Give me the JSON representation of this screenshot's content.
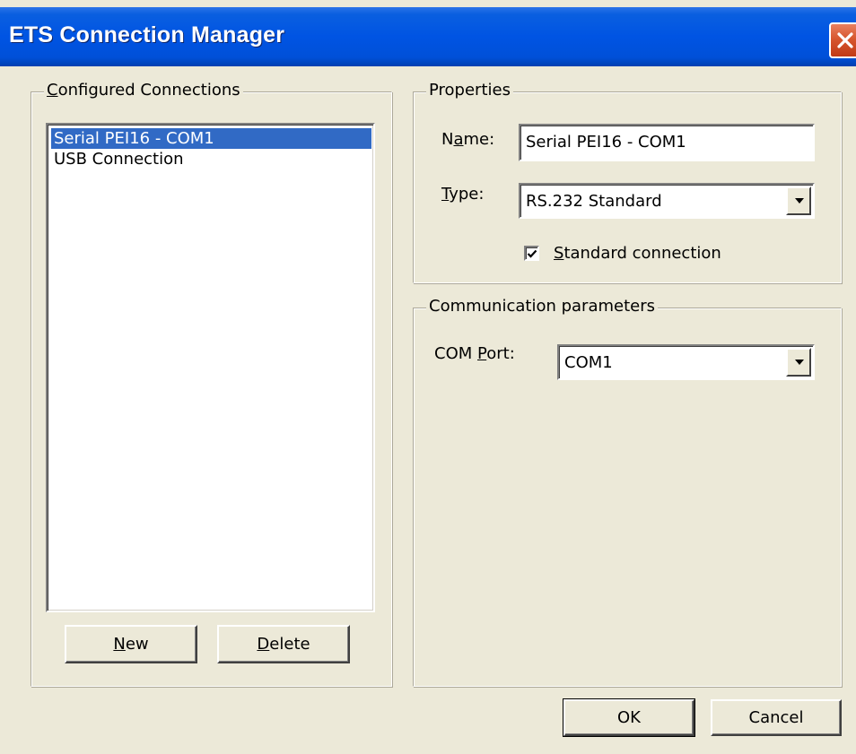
{
  "window": {
    "title": "ETS Connection Manager"
  },
  "configured_connections": {
    "legend_first": "C",
    "legend_rest": "onfigured Connections",
    "items": [
      {
        "label": "Serial PEI16 - COM1",
        "selected": true
      },
      {
        "label": "USB Connection",
        "selected": false
      }
    ],
    "new_button": {
      "first": "N",
      "rest": "ew"
    },
    "delete_button": {
      "first": "D",
      "rest": "elete"
    }
  },
  "properties": {
    "legend": "Properties",
    "name_label": {
      "before": "N",
      "underlined": "a",
      "after": "me:"
    },
    "name_value": "Serial PEI16 - COM1",
    "type_label": {
      "underlined": "T",
      "after": "ype:"
    },
    "type_value": "RS.232 Standard",
    "standard_connection": {
      "first": "S",
      "rest": "tandard connection",
      "checked": true
    }
  },
  "communication": {
    "legend": "Communication parameters",
    "com_port_label": {
      "before": "COM ",
      "underlined": "P",
      "after": "ort:"
    },
    "com_port_value": "COM1"
  },
  "footer": {
    "ok_label": "OK",
    "cancel_label": "Cancel"
  },
  "colors": {
    "titlebar": "#0054e3",
    "selection": "#316ac5",
    "dialog_background": "#ece9d8",
    "close_button": "#d7572f"
  },
  "icons": {
    "close": "close-icon",
    "dropdown": "chevron-down-icon",
    "check": "checkmark-icon"
  }
}
